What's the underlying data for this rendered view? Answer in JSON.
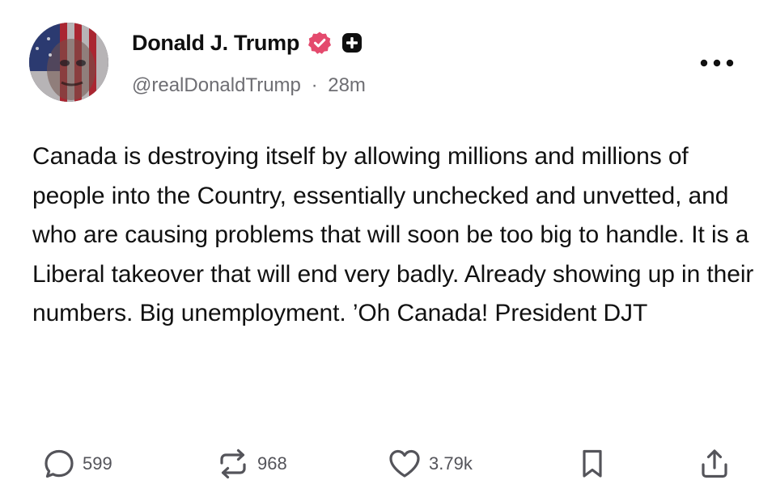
{
  "author": {
    "display_name": "Donald J. Trump",
    "handle": "@realDonaldTrump",
    "separator": "·",
    "time_ago": "28m",
    "verified_badge_color": "#e44a6d",
    "plus_badge_color": "#0f0f0f"
  },
  "post": {
    "text": "Canada is destroying itself by allowing millions and millions of people into the Country, essentially unchecked and unvetted, and who are causing problems that will soon be too big to handle. It is a Liberal takeover that will end very badly. Already showing up in their numbers. Big unemployment. ’Oh Canada! President DJT"
  },
  "actions": {
    "replies": {
      "icon": "reply-icon",
      "count": "599"
    },
    "reposts": {
      "icon": "repost-icon",
      "count": "968"
    },
    "likes": {
      "icon": "heart-icon",
      "count": "3.79k"
    },
    "bookmark": {
      "icon": "bookmark-icon"
    },
    "share": {
      "icon": "share-icon"
    }
  },
  "menu": {
    "icon": "more-icon"
  },
  "colors": {
    "text": "#111111",
    "muted": "#6e6e73",
    "icon": "#54545a",
    "background": "#ffffff"
  }
}
